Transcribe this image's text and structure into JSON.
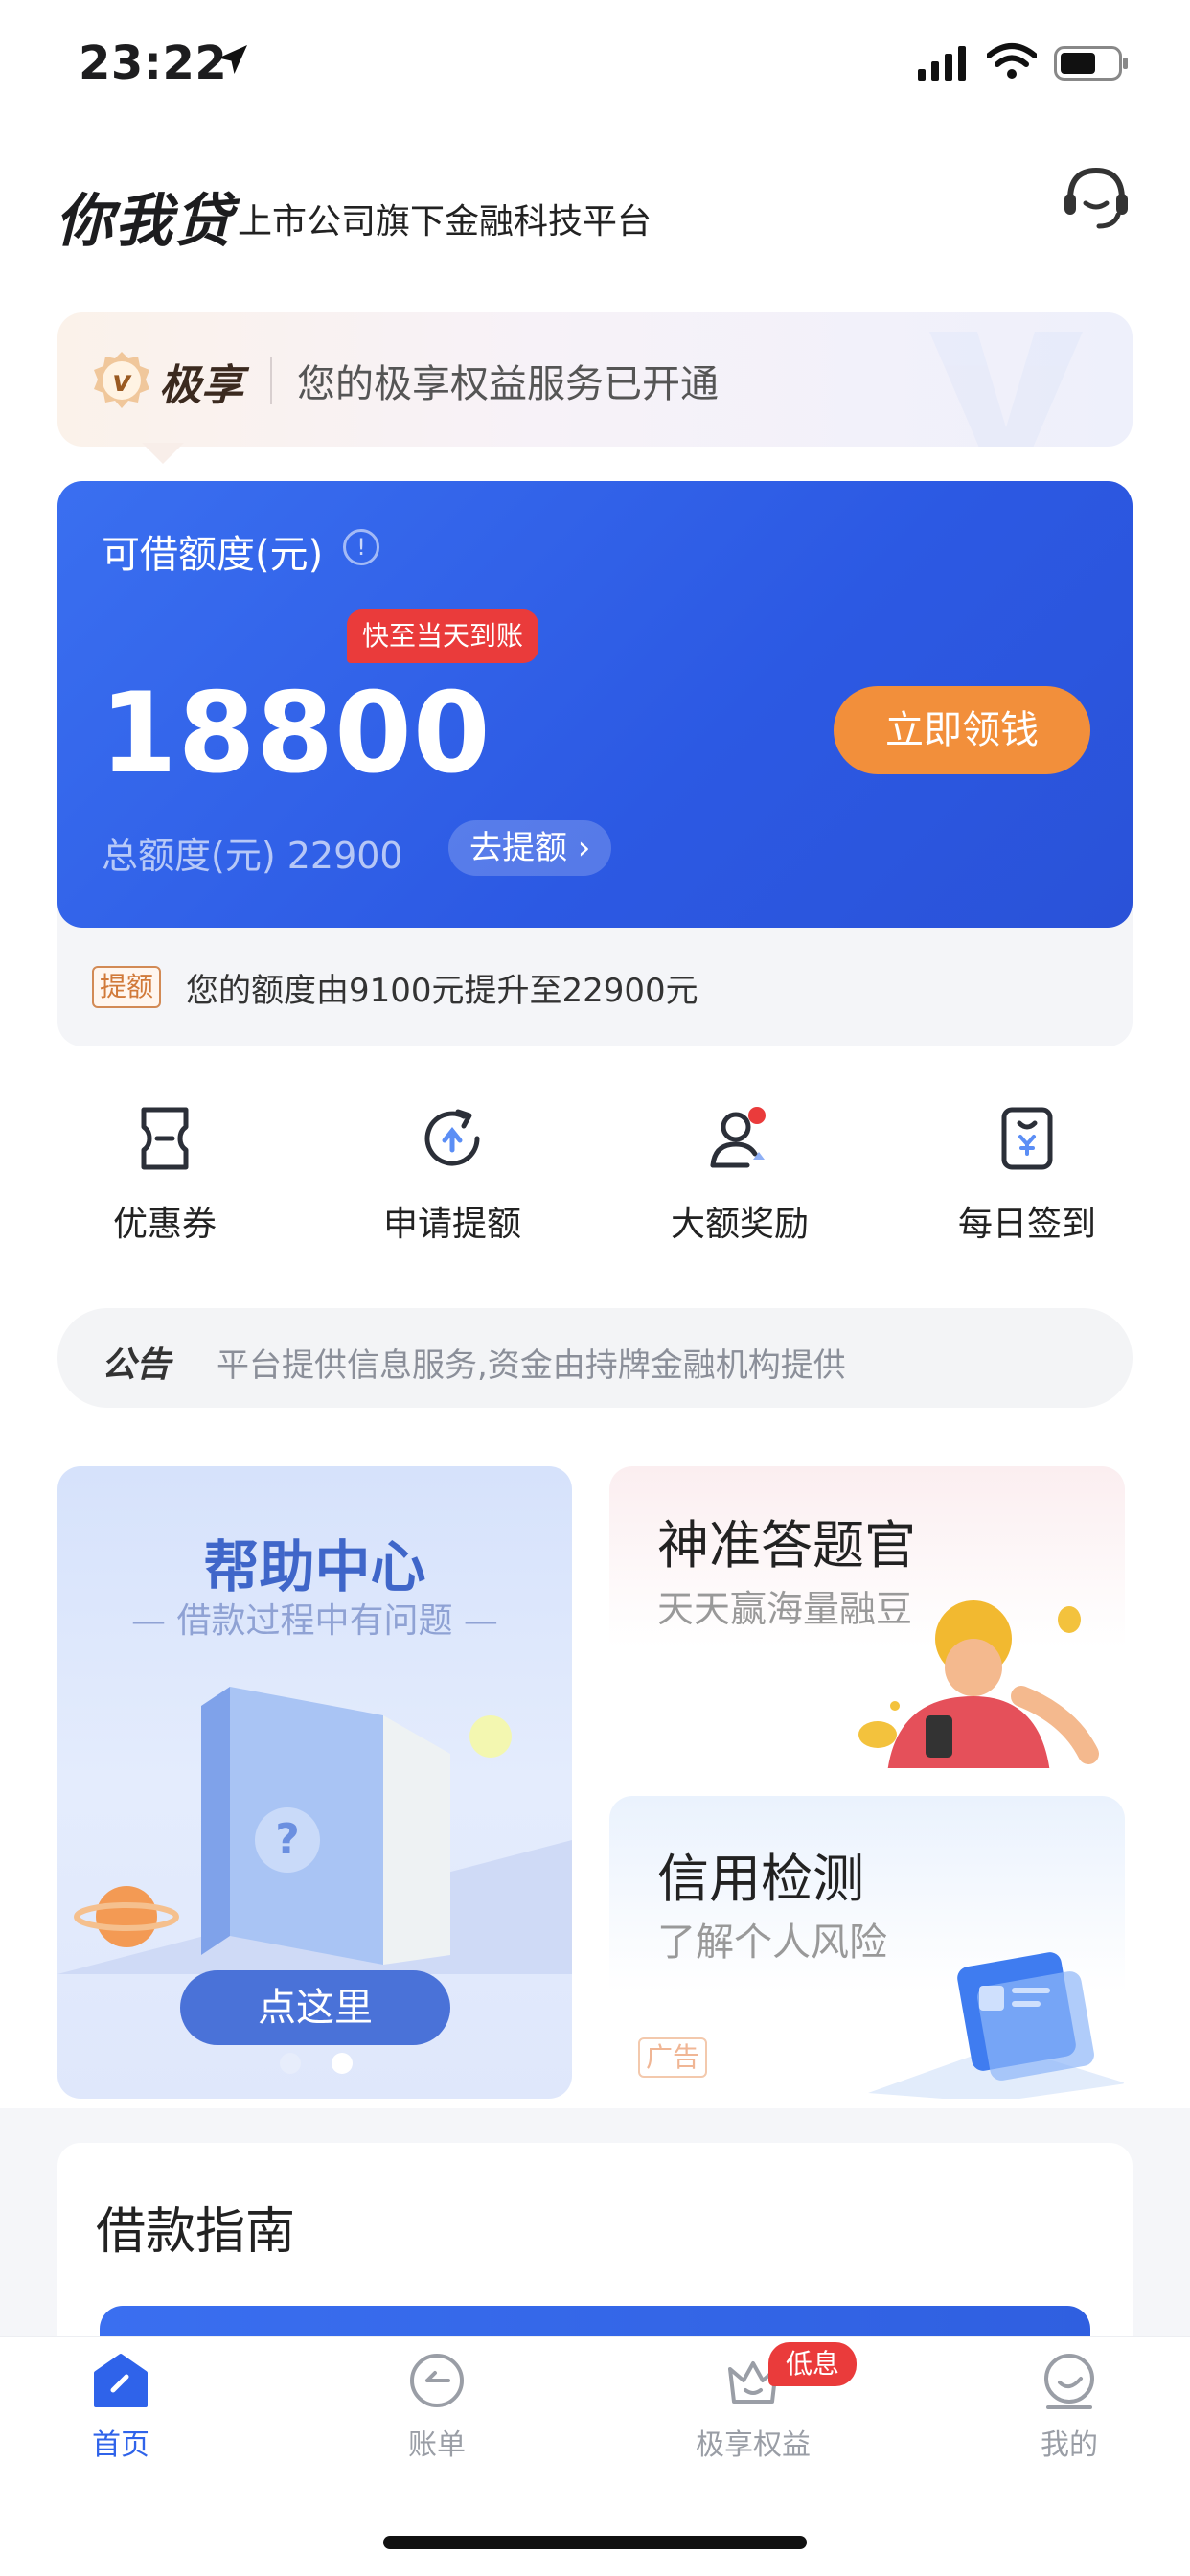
{
  "status_bar": {
    "time": "23:22"
  },
  "header": {
    "brand": "你我贷",
    "subtitle": "上市公司旗下金融科技平台"
  },
  "vip_banner": {
    "title": "极享",
    "text": "您的极享权益服务已开通"
  },
  "credit": {
    "label": "可借额度(元)",
    "info": "!",
    "tag": "快至当天到账",
    "amount": "18800",
    "cta": "立即领钱",
    "total": "总额度(元) 22900",
    "raise": "去提额 ›"
  },
  "raise_notice": {
    "tag": "提额",
    "text": "您的额度由9100元提升至22900元"
  },
  "quick_actions": [
    {
      "label": "优惠券",
      "icon": "coupon-icon"
    },
    {
      "label": "申请提额",
      "icon": "raise-limit-icon"
    },
    {
      "label": "大额奖励",
      "icon": "reward-user-icon"
    },
    {
      "label": "每日签到",
      "icon": "checkin-icon"
    }
  ],
  "announcement": {
    "tag": "公告",
    "text": "平台提供信息服务,资金由持牌金融机构提供"
  },
  "promos": {
    "help": {
      "title": "帮助中心",
      "subtitle": "— 借款过程中有问题 —",
      "button": "点这里"
    },
    "quiz": {
      "title": "神准答题官",
      "subtitle": "天天赢海量融豆"
    },
    "credit_check": {
      "title": "信用检测",
      "subtitle": "了解个人风险",
      "ad": "广告"
    }
  },
  "guide": {
    "title": "借款指南"
  },
  "tabbar": [
    {
      "label": "首页",
      "icon": "home-icon",
      "active": true
    },
    {
      "label": "账单",
      "icon": "bill-icon"
    },
    {
      "label": "极享权益",
      "icon": "crown-icon",
      "badge": "低息"
    },
    {
      "label": "我的",
      "icon": "profile-icon"
    }
  ],
  "colors": {
    "primary": "#2f63ea",
    "orange_cta": "#f28f3b",
    "red_tag": "#ea3b3b"
  }
}
